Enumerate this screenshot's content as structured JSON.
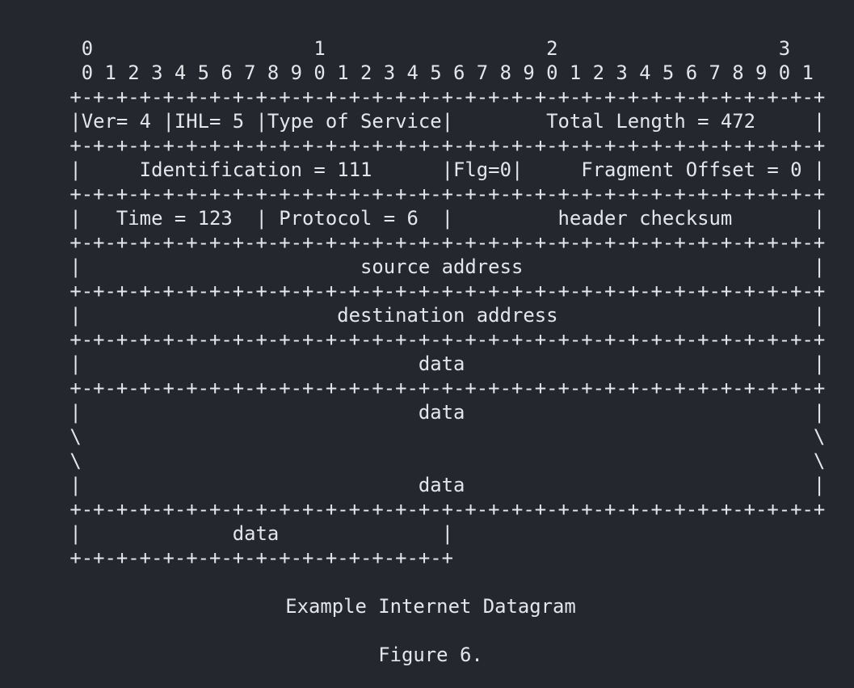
{
  "diagram": {
    "lines": [
      "  0                   1                   2                   3",
      "  0 1 2 3 4 5 6 7 8 9 0 1 2 3 4 5 6 7 8 9 0 1 2 3 4 5 6 7 8 9 0 1",
      " +-+-+-+-+-+-+-+-+-+-+-+-+-+-+-+-+-+-+-+-+-+-+-+-+-+-+-+-+-+-+-+-+",
      " |Ver= 4 |IHL= 5 |Type of Service|        Total Length = 472     |",
      " +-+-+-+-+-+-+-+-+-+-+-+-+-+-+-+-+-+-+-+-+-+-+-+-+-+-+-+-+-+-+-+-+",
      " |     Identification = 111      |Flg=0|     Fragment Offset = 0 |",
      " +-+-+-+-+-+-+-+-+-+-+-+-+-+-+-+-+-+-+-+-+-+-+-+-+-+-+-+-+-+-+-+-+",
      " |   Time = 123  | Protocol = 6  |         header checksum       |",
      " +-+-+-+-+-+-+-+-+-+-+-+-+-+-+-+-+-+-+-+-+-+-+-+-+-+-+-+-+-+-+-+-+",
      " |                        source address                         |",
      " +-+-+-+-+-+-+-+-+-+-+-+-+-+-+-+-+-+-+-+-+-+-+-+-+-+-+-+-+-+-+-+-+",
      " |                      destination address                      |",
      " +-+-+-+-+-+-+-+-+-+-+-+-+-+-+-+-+-+-+-+-+-+-+-+-+-+-+-+-+-+-+-+-+",
      " |                             data                              |",
      " +-+-+-+-+-+-+-+-+-+-+-+-+-+-+-+-+-+-+-+-+-+-+-+-+-+-+-+-+-+-+-+-+",
      " |                             data                              |",
      " \\                                                               \\",
      " \\                                                               \\",
      " |                             data                              |",
      " +-+-+-+-+-+-+-+-+-+-+-+-+-+-+-+-+-+-+-+-+-+-+-+-+-+-+-+-+-+-+-+-+",
      " |             data              |",
      " +-+-+-+-+-+-+-+-+-+-+-+-+-+-+-+-+"
    ],
    "caption_title": "Example Internet Datagram",
    "caption_figure": "Figure 6."
  },
  "colors": {
    "background": "#24272e",
    "text": "#e4e6ea"
  }
}
